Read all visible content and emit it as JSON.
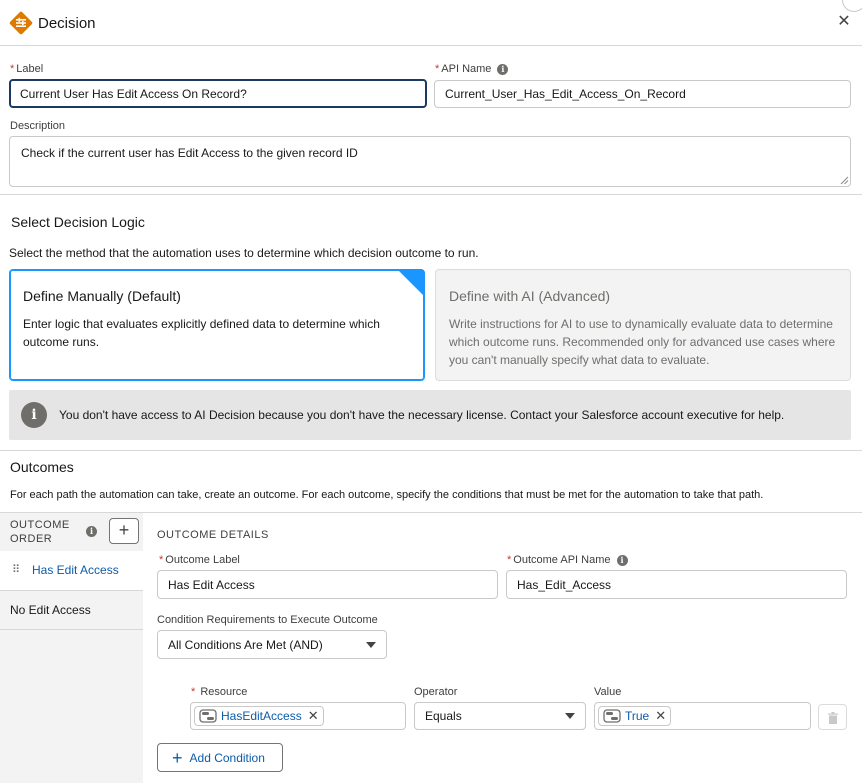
{
  "header": {
    "title": "Decision"
  },
  "fields": {
    "label": {
      "label": "Label",
      "value": "Current User Has Edit Access On Record?"
    },
    "api_name": {
      "label": "API Name",
      "value": "Current_User_Has_Edit_Access_On_Record"
    },
    "description": {
      "label": "Description",
      "value": "Check if the current user has Edit Access to the given record ID"
    }
  },
  "logic": {
    "title": "Select Decision Logic",
    "help": "Select the method that the automation uses to determine which decision outcome to run.",
    "manual": {
      "title": "Define Manually (Default)",
      "body": "Enter logic that evaluates explicitly defined data to determine which outcome runs."
    },
    "ai": {
      "title": "Define with AI (Advanced)",
      "body": "Write instructions for AI to use to dynamically evaluate data to determine which outcome runs. Recommended only for advanced use cases where you can't manually specify what data to evaluate."
    },
    "alert": "You don't have access to AI Decision because you don't have the necessary license. Contact your Salesforce account executive for help."
  },
  "outcomes": {
    "title": "Outcomes",
    "help": "For each path the automation can take, create an outcome. For each outcome, specify the conditions that must be met for the automation to take that path.",
    "order_header_line1": "OUTCOME",
    "order_header_line2": "ORDER",
    "items": [
      {
        "label": "Has Edit Access"
      },
      {
        "label": "No Edit Access"
      }
    ],
    "details": {
      "header": "OUTCOME DETAILS",
      "label_field": {
        "label": "Outcome Label",
        "value": "Has Edit Access"
      },
      "api_field": {
        "label": "Outcome API Name",
        "value": "Has_Edit_Access"
      },
      "requirements": {
        "label": "Condition Requirements to Execute Outcome",
        "value": "All Conditions Are Met (AND)"
      },
      "condition": {
        "resource_label": "Resource",
        "resource_value": "HasEditAccess",
        "operator_label": "Operator",
        "operator_value": "Equals",
        "value_label": "Value",
        "value_value": "True"
      },
      "add_condition": "Add Condition"
    }
  },
  "colors": {
    "accent": "#1b96ff",
    "brand_icon": "#dd7a01",
    "link": "#0b5cab"
  }
}
